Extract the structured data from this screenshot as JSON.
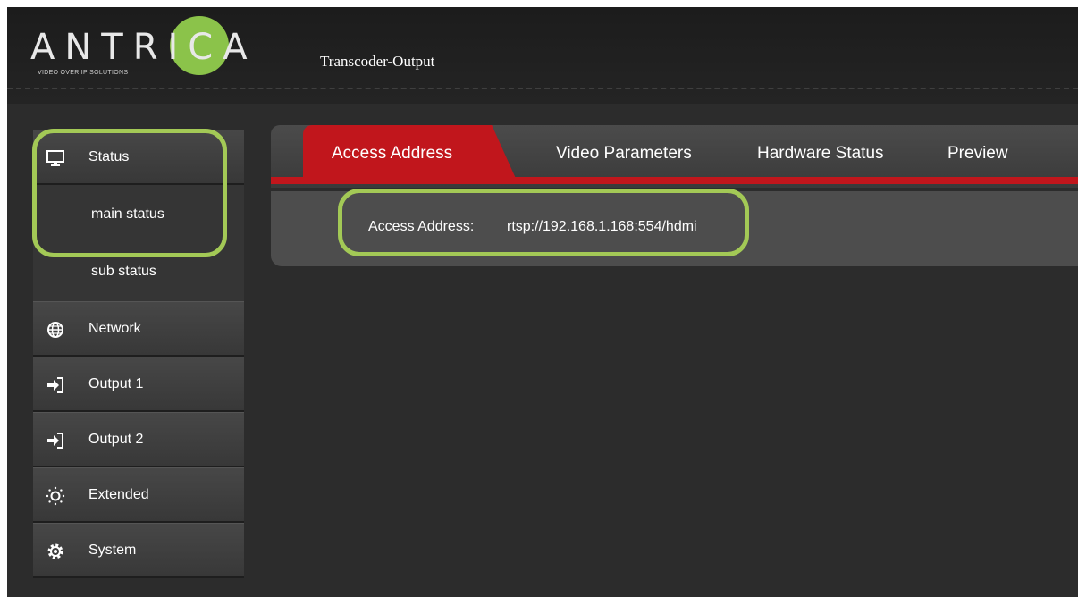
{
  "header": {
    "logo_text": "ANTRICA",
    "logo_tagline": "VIDEO OVER IP SOLUTIONS",
    "title": "Transcoder-Output"
  },
  "sidebar": {
    "items": [
      {
        "label": "Status",
        "icon": "monitor-icon"
      },
      {
        "label": "main status"
      },
      {
        "label": "sub status"
      },
      {
        "label": "Network",
        "icon": "globe-icon"
      },
      {
        "label": "Output 1",
        "icon": "sign-in-icon"
      },
      {
        "label": "Output 2",
        "icon": "sign-in-icon"
      },
      {
        "label": "Extended",
        "icon": "sun-dots-icon"
      },
      {
        "label": "System",
        "icon": "gear-icon"
      }
    ]
  },
  "tabs": {
    "items": [
      {
        "label": "Access Address",
        "active": true
      },
      {
        "label": "Video Parameters"
      },
      {
        "label": "Hardware Status"
      },
      {
        "label": "Preview"
      }
    ]
  },
  "content": {
    "access_label": "Access Address:",
    "access_value": "rtsp://192.168.1.168:554/hdmi"
  },
  "colors": {
    "accent_red": "#c1161c",
    "highlight_green": "#a3c956",
    "logo_green": "#8bc34a"
  }
}
